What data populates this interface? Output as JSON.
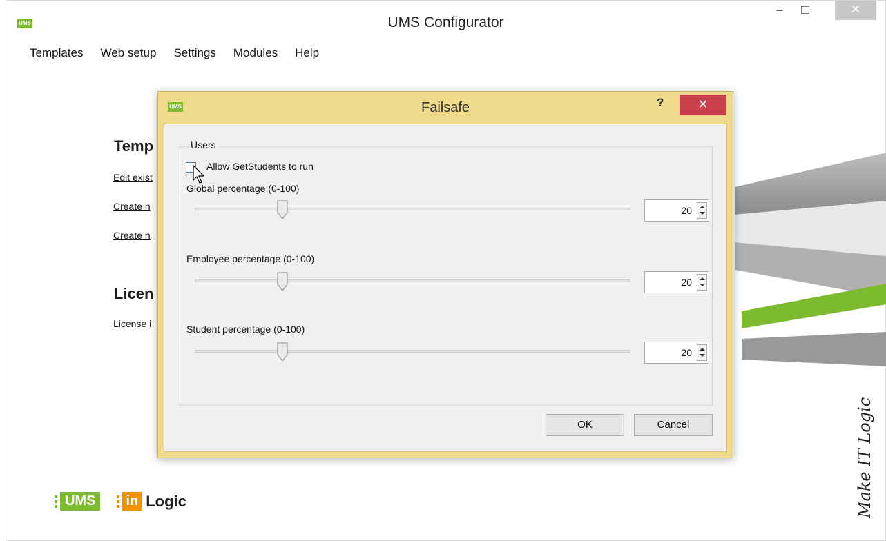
{
  "window": {
    "title": "UMS Configurator",
    "badge": "UMS",
    "min_glyph": "–",
    "close_glyph": "✕"
  },
  "menu": [
    "Templates",
    "Web setup",
    "Settings",
    "Modules",
    "Help"
  ],
  "main": {
    "section_templates": "Temp",
    "links": [
      "Edit exist",
      "Create n",
      "Create n"
    ],
    "section_license": "Licen",
    "license_link": "License i"
  },
  "logos": {
    "ums": "UMS",
    "in": "in",
    "logic": "Logic",
    "tagline": "Make IT Logic"
  },
  "dialog": {
    "badge": "UMS",
    "title": "Failsafe",
    "help_glyph": "?",
    "close_glyph": "✕",
    "group_label": "Users",
    "checkbox_label": "Allow GetStudents to run",
    "checkbox_checked": false,
    "global": {
      "label": "Global percentage (0-100)",
      "value": "20",
      "level": 20
    },
    "employee": {
      "label": "Employee percentage (0-100)",
      "value": "20",
      "level": 20
    },
    "student": {
      "label": "Student percentage (0-100)",
      "value": "20",
      "level": 20
    },
    "ok": "OK",
    "cancel": "Cancel"
  },
  "colors": {
    "dialog_frame": "#efd98a",
    "close_red": "#c9404a",
    "brand_green": "#7dbb2e",
    "brand_orange": "#f39200"
  }
}
